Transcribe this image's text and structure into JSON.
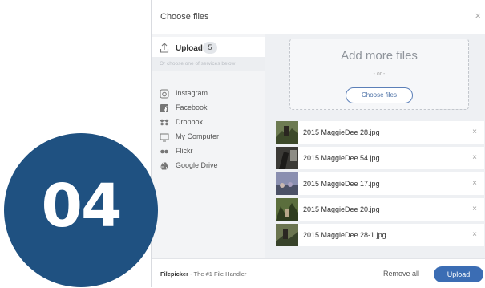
{
  "dialog": {
    "title": "Choose files",
    "close_glyph": "×"
  },
  "sidebar": {
    "upload": {
      "label": "Upload",
      "count": "5",
      "icon": "upload-icon"
    },
    "hint": "Or choose one of services below",
    "sources": [
      {
        "label": "Instagram",
        "icon": "instagram-icon"
      },
      {
        "label": "Facebook",
        "icon": "facebook-icon"
      },
      {
        "label": "Dropbox",
        "icon": "dropbox-icon"
      },
      {
        "label": "My Computer",
        "icon": "computer-icon"
      },
      {
        "label": "Flickr",
        "icon": "flickr-icon"
      },
      {
        "label": "Google Drive",
        "icon": "google-drive-icon"
      }
    ]
  },
  "dropzone": {
    "title": "Add more files",
    "or": "- or -",
    "button": "Choose files"
  },
  "files": [
    {
      "name": "2015 MaggieDee 28.jpg",
      "remove": "×"
    },
    {
      "name": "2015 MaggieDee 54.jpg",
      "remove": "×"
    },
    {
      "name": "2015 MaggieDee 17.jpg",
      "remove": "×"
    },
    {
      "name": "2015 MaggieDee 20.jpg",
      "remove": "×"
    },
    {
      "name": "2015 MaggieDee 28-1.jpg",
      "remove": "×"
    }
  ],
  "footer": {
    "brand": "Filepicker",
    "tagline": " - The #1 File Handler",
    "remove_all": "Remove all",
    "upload": "Upload"
  },
  "overlay": {
    "number": "04"
  },
  "colors": {
    "accent": "#3b6db4",
    "badge_circle": "#1f5181"
  }
}
